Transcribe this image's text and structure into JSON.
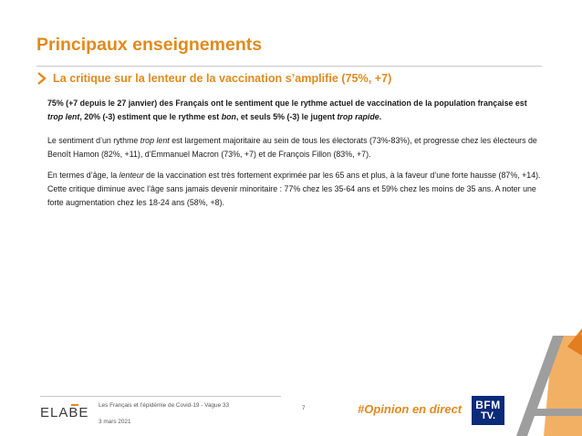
{
  "header": {
    "title": "Principaux enseignements",
    "subtitle": "La critique sur la lenteur de la vaccination s’amplifie (75%, +7)"
  },
  "content": {
    "p1": {
      "a": "75% (+7 depuis le 27 janvier) des Français ont le sentiment que le rythme actuel de vaccination de la population française est ",
      "b": "trop lent",
      "c": ", 20% (-3) estiment que le rythme est ",
      "d": "bon",
      "e": ", et seuls 5% (-3) le jugent ",
      "f": "trop rapide",
      "g": "."
    },
    "p2": {
      "a": "Le sentiment d’un rythme ",
      "b": "trop lent",
      "c": " est largement majoritaire au sein de tous les électorats (73%-83%), et progresse chez les électeurs de Benoît Hamon (82%, +11), d’Emmanuel Macron (73%, +7) et de François Fillon (83%, +7)."
    },
    "p3": {
      "a": "En termes d’âge, la ",
      "b": "lenteur",
      "c": " de la vaccination est très fortement exprimée par les 65 ans et plus, à la faveur d’une forte hausse (87%, +14). Cette critique diminue avec l’âge sans jamais devenir minoritaire : 77% chez les 35-64 ans et 59% chez les moins de 35 ans. A noter une forte augmentation chez les 18-24 ans (58%, +8)."
    }
  },
  "footer": {
    "logo_text": "ELABE",
    "study": "Les Français et l’épidémie de Covid-19 - Vague 33",
    "date": "3 mars 2021",
    "page": "7",
    "hashtag": "#Opinion en direct",
    "partner_line1": "BFM",
    "partner_line2": "TV."
  },
  "colors": {
    "accent": "#e08a1e",
    "bfm_blue": "#0a2a7a",
    "rule": "#c9c9c9"
  },
  "icons": {
    "bullet": "chevron-right-icon",
    "decor": "stylized-a-logo"
  }
}
